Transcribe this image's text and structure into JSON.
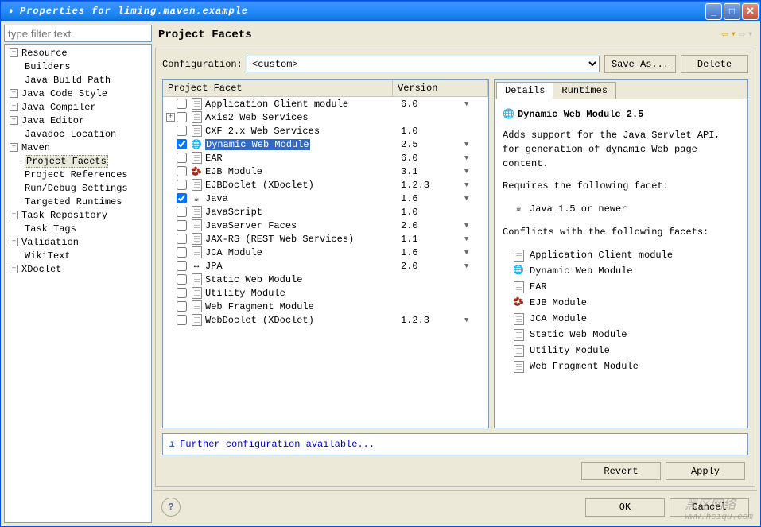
{
  "window": {
    "title": "Properties for liming.maven.example"
  },
  "filter_placeholder": "type filter text",
  "tree": [
    {
      "label": "Resource",
      "exp": "+",
      "indent": 0
    },
    {
      "label": "Builders",
      "indent": 1
    },
    {
      "label": "Java Build Path",
      "indent": 1
    },
    {
      "label": "Java Code Style",
      "exp": "+",
      "indent": 0
    },
    {
      "label": "Java Compiler",
      "exp": "+",
      "indent": 0
    },
    {
      "label": "Java Editor",
      "exp": "+",
      "indent": 0
    },
    {
      "label": "Javadoc Location",
      "indent": 1
    },
    {
      "label": "Maven",
      "exp": "+",
      "indent": 0
    },
    {
      "label": "Project Facets",
      "indent": 1,
      "selected": true
    },
    {
      "label": "Project References",
      "indent": 1
    },
    {
      "label": "Run/Debug Settings",
      "indent": 1
    },
    {
      "label": "Targeted Runtimes",
      "indent": 1
    },
    {
      "label": "Task Repository",
      "exp": "+",
      "indent": 0
    },
    {
      "label": "Task Tags",
      "indent": 1
    },
    {
      "label": "Validation",
      "exp": "+",
      "indent": 0
    },
    {
      "label": "WikiText",
      "indent": 1
    },
    {
      "label": "XDoclet",
      "exp": "+",
      "indent": 0
    }
  ],
  "page": {
    "title": "Project Facets",
    "config_label": "Configuration:",
    "config_value": "<custom>",
    "save_as": "Save As...",
    "delete": "Delete",
    "col_facet": "Project Facet",
    "col_version": "Version"
  },
  "facets": [
    {
      "name": "Application Client module",
      "version": "6.0",
      "dd": true,
      "indent": 0,
      "icon": "📄"
    },
    {
      "name": "Axis2 Web Services",
      "version": "",
      "exp": "+",
      "indent": 0,
      "icon": "📄"
    },
    {
      "name": "CXF 2.x Web Services",
      "version": "1.0",
      "indent": 1,
      "icon": "📄"
    },
    {
      "name": "Dynamic Web Module",
      "version": "2.5",
      "dd": true,
      "checked": true,
      "selected": true,
      "indent": 1,
      "icon": "🌐"
    },
    {
      "name": "EAR",
      "version": "6.0",
      "dd": true,
      "indent": 1,
      "icon": "📄"
    },
    {
      "name": "EJB Module",
      "version": "3.1",
      "dd": true,
      "indent": 1,
      "icon": "🫘"
    },
    {
      "name": "EJBDoclet (XDoclet)",
      "version": "1.2.3",
      "dd": true,
      "indent": 1,
      "icon": "📄"
    },
    {
      "name": "Java",
      "version": "1.6",
      "dd": true,
      "checked": true,
      "indent": 0,
      "icon": "☕"
    },
    {
      "name": "JavaScript",
      "version": "1.0",
      "indent": 1,
      "icon": "📄"
    },
    {
      "name": "JavaServer Faces",
      "version": "2.0",
      "dd": true,
      "indent": 1,
      "icon": "📄"
    },
    {
      "name": "JAX-RS (REST Web Services)",
      "version": "1.1",
      "dd": true,
      "indent": 1,
      "icon": "📄"
    },
    {
      "name": "JCA Module",
      "version": "1.6",
      "dd": true,
      "indent": 1,
      "icon": "📄"
    },
    {
      "name": "JPA",
      "version": "2.0",
      "dd": true,
      "indent": 0,
      "icon": "↔"
    },
    {
      "name": "Static Web Module",
      "version": "",
      "indent": 1,
      "icon": "📄"
    },
    {
      "name": "Utility Module",
      "version": "",
      "indent": 1,
      "icon": "📄"
    },
    {
      "name": "Web Fragment Module",
      "version": "",
      "indent": 1,
      "icon": "📄"
    },
    {
      "name": "WebDoclet (XDoclet)",
      "version": "1.2.3",
      "dd": true,
      "indent": 1,
      "icon": "📄"
    }
  ],
  "tabs": {
    "details": "Details",
    "runtimes": "Runtimes"
  },
  "details": {
    "title": "Dynamic Web Module 2.5",
    "desc": "Adds support for the Java Servlet API, for generation of dynamic Web page content.",
    "requires_label": "Requires the following facet:",
    "requires": [
      {
        "icon": "☕",
        "label": "Java 1.5 or newer"
      }
    ],
    "conflicts_label": "Conflicts with the following facets:",
    "conflicts": [
      {
        "icon": "📄",
        "label": "Application Client module"
      },
      {
        "icon": "🌐",
        "label": "Dynamic Web Module"
      },
      {
        "icon": "📄",
        "label": "EAR"
      },
      {
        "icon": "🫘",
        "label": "EJB Module"
      },
      {
        "icon": "📄",
        "label": "JCA Module"
      },
      {
        "icon": "📄",
        "label": "Static Web Module"
      },
      {
        "icon": "📄",
        "label": "Utility Module"
      },
      {
        "icon": "📄",
        "label": "Web Fragment Module"
      }
    ]
  },
  "info_link": "Further configuration available...",
  "buttons": {
    "revert": "Revert",
    "apply": "Apply",
    "ok": "OK",
    "cancel": "Cancel"
  },
  "watermark": {
    "line1": "黑区网络",
    "line2": "www.hciqu.com"
  }
}
